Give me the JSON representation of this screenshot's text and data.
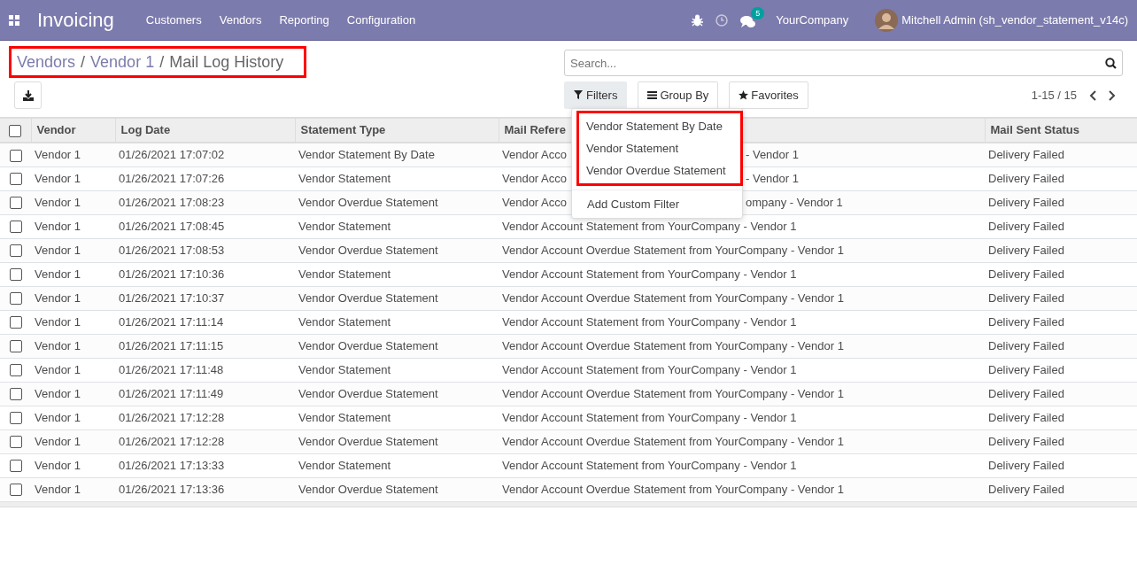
{
  "navbar": {
    "app_title": "Invoicing",
    "menu": [
      "Customers",
      "Vendors",
      "Reporting",
      "Configuration"
    ],
    "chat_badge": "5",
    "company": "YourCompany",
    "user": "Mitchell Admin (sh_vendor_statement_v14c)"
  },
  "breadcrumb": {
    "highlighted": true,
    "items": [
      {
        "kind": "link",
        "label": "Vendors"
      },
      {
        "kind": "separator",
        "label": "/"
      },
      {
        "kind": "link",
        "label": "Vendor 1"
      },
      {
        "kind": "separator",
        "label": "/"
      },
      {
        "kind": "current",
        "label": "Mail Log History"
      }
    ]
  },
  "search": {
    "placeholder": "Search..."
  },
  "search_buttons": [
    {
      "kind": "filters",
      "label": "Filters",
      "selected": true
    },
    {
      "kind": "group_by",
      "label": "Group By",
      "selected": false
    },
    {
      "kind": "favorites",
      "label": "Favorites",
      "selected": false
    }
  ],
  "pager": "1-15 / 15",
  "filters_menu": {
    "highlighted": true,
    "items": [
      "Vendor Statement By Date",
      "Vendor Statement",
      "Vendor Overdue Statement"
    ],
    "custom": "Add Custom Filter"
  },
  "table": {
    "header_checked": false,
    "columns": [
      "Vendor",
      "Log Date",
      "Statement Type",
      "Mail Refere",
      "Mail Sent Status"
    ],
    "rows": [
      {
        "checked": false,
        "vendor": "Vendor 1",
        "log_date": "01/26/2021 17:07:02",
        "statement_type": "Vendor Statement By Date",
        "mail_reference_parts": [
          "Vendor Acco",
          "- Vendor 1"
        ],
        "status": "Delivery Failed"
      },
      {
        "checked": false,
        "vendor": "Vendor 1",
        "log_date": "01/26/2021 17:07:26",
        "statement_type": "Vendor Statement",
        "mail_reference_parts": [
          "Vendor Acco",
          "- Vendor 1"
        ],
        "status": "Delivery Failed"
      },
      {
        "checked": false,
        "vendor": "Vendor 1",
        "log_date": "01/26/2021 17:08:23",
        "statement_type": "Vendor Overdue Statement",
        "mail_reference_parts": [
          "Vendor Acco",
          "ompany - Vendor 1"
        ],
        "status": "Delivery Failed"
      },
      {
        "checked": false,
        "vendor": "Vendor 1",
        "log_date": "01/26/2021 17:08:45",
        "statement_type": "Vendor Statement",
        "mail_reference": "Vendor Account Statement from YourCompany - Vendor 1",
        "status": "Delivery Failed"
      },
      {
        "checked": false,
        "vendor": "Vendor 1",
        "log_date": "01/26/2021 17:08:53",
        "statement_type": "Vendor Overdue Statement",
        "mail_reference": "Vendor Account Overdue Statement from YourCompany - Vendor 1",
        "status": "Delivery Failed"
      },
      {
        "checked": false,
        "vendor": "Vendor 1",
        "log_date": "01/26/2021 17:10:36",
        "statement_type": "Vendor Statement",
        "mail_reference": "Vendor Account Statement from YourCompany - Vendor 1",
        "status": "Delivery Failed"
      },
      {
        "checked": false,
        "vendor": "Vendor 1",
        "log_date": "01/26/2021 17:10:37",
        "statement_type": "Vendor Overdue Statement",
        "mail_reference": "Vendor Account Overdue Statement from YourCompany - Vendor 1",
        "status": "Delivery Failed"
      },
      {
        "checked": false,
        "vendor": "Vendor 1",
        "log_date": "01/26/2021 17:11:14",
        "statement_type": "Vendor Statement",
        "mail_reference": "Vendor Account Statement from YourCompany - Vendor 1",
        "status": "Delivery Failed"
      },
      {
        "checked": false,
        "vendor": "Vendor 1",
        "log_date": "01/26/2021 17:11:15",
        "statement_type": "Vendor Overdue Statement",
        "mail_reference": "Vendor Account Overdue Statement from YourCompany - Vendor 1",
        "status": "Delivery Failed"
      },
      {
        "checked": false,
        "vendor": "Vendor 1",
        "log_date": "01/26/2021 17:11:48",
        "statement_type": "Vendor Statement",
        "mail_reference": "Vendor Account Statement from YourCompany - Vendor 1",
        "status": "Delivery Failed"
      },
      {
        "checked": false,
        "vendor": "Vendor 1",
        "log_date": "01/26/2021 17:11:49",
        "statement_type": "Vendor Overdue Statement",
        "mail_reference": "Vendor Account Overdue Statement from YourCompany - Vendor 1",
        "status": "Delivery Failed"
      },
      {
        "checked": false,
        "vendor": "Vendor 1",
        "log_date": "01/26/2021 17:12:28",
        "statement_type": "Vendor Statement",
        "mail_reference": "Vendor Account Statement from YourCompany - Vendor 1",
        "status": "Delivery Failed"
      },
      {
        "checked": false,
        "vendor": "Vendor 1",
        "log_date": "01/26/2021 17:12:28",
        "statement_type": "Vendor Overdue Statement",
        "mail_reference": "Vendor Account Overdue Statement from YourCompany - Vendor 1",
        "status": "Delivery Failed"
      },
      {
        "checked": false,
        "vendor": "Vendor 1",
        "log_date": "01/26/2021 17:13:33",
        "statement_type": "Vendor Statement",
        "mail_reference": "Vendor Account Statement from YourCompany - Vendor 1",
        "status": "Delivery Failed"
      },
      {
        "checked": false,
        "vendor": "Vendor 1",
        "log_date": "01/26/2021 17:13:36",
        "statement_type": "Vendor Overdue Statement",
        "mail_reference": "Vendor Account Overdue Statement from YourCompany - Vendor 1",
        "status": "Delivery Failed"
      }
    ]
  }
}
